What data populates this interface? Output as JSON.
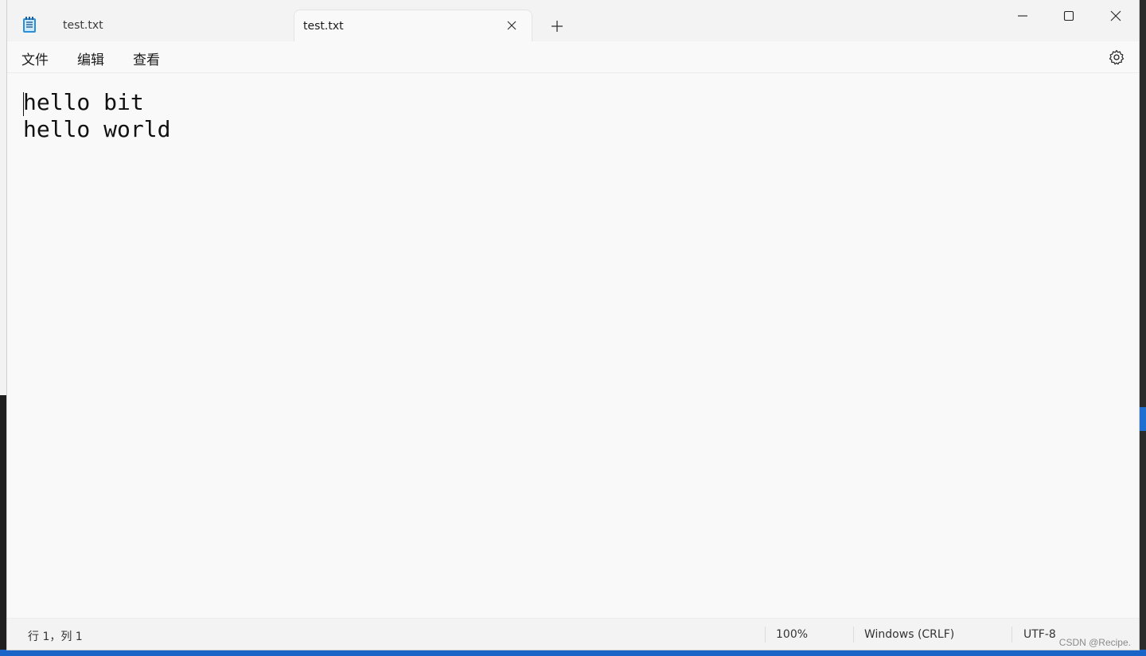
{
  "tabs": [
    {
      "label": "test.txt",
      "active": false
    },
    {
      "label": "test.txt",
      "active": true
    }
  ],
  "menu": {
    "file": "文件",
    "edit": "编辑",
    "view": "查看"
  },
  "editor": {
    "lines": [
      "hello bit",
      "hello world"
    ]
  },
  "status": {
    "position": "行 1，列 1",
    "zoom": "100%",
    "line_ending": "Windows (CRLF)",
    "encoding": "UTF-8"
  },
  "watermark": "CSDN @Recipe.",
  "icons": {
    "app": "notepad-icon",
    "tab_close": "close-icon",
    "new_tab": "plus-icon",
    "minimize": "minimize-icon",
    "maximize": "maximize-icon",
    "close": "close-icon",
    "settings": "gear-icon"
  },
  "colors": {
    "accent": "#1e6fd0",
    "background": "#f9f9f9",
    "titlebar": "#f3f3f3"
  }
}
